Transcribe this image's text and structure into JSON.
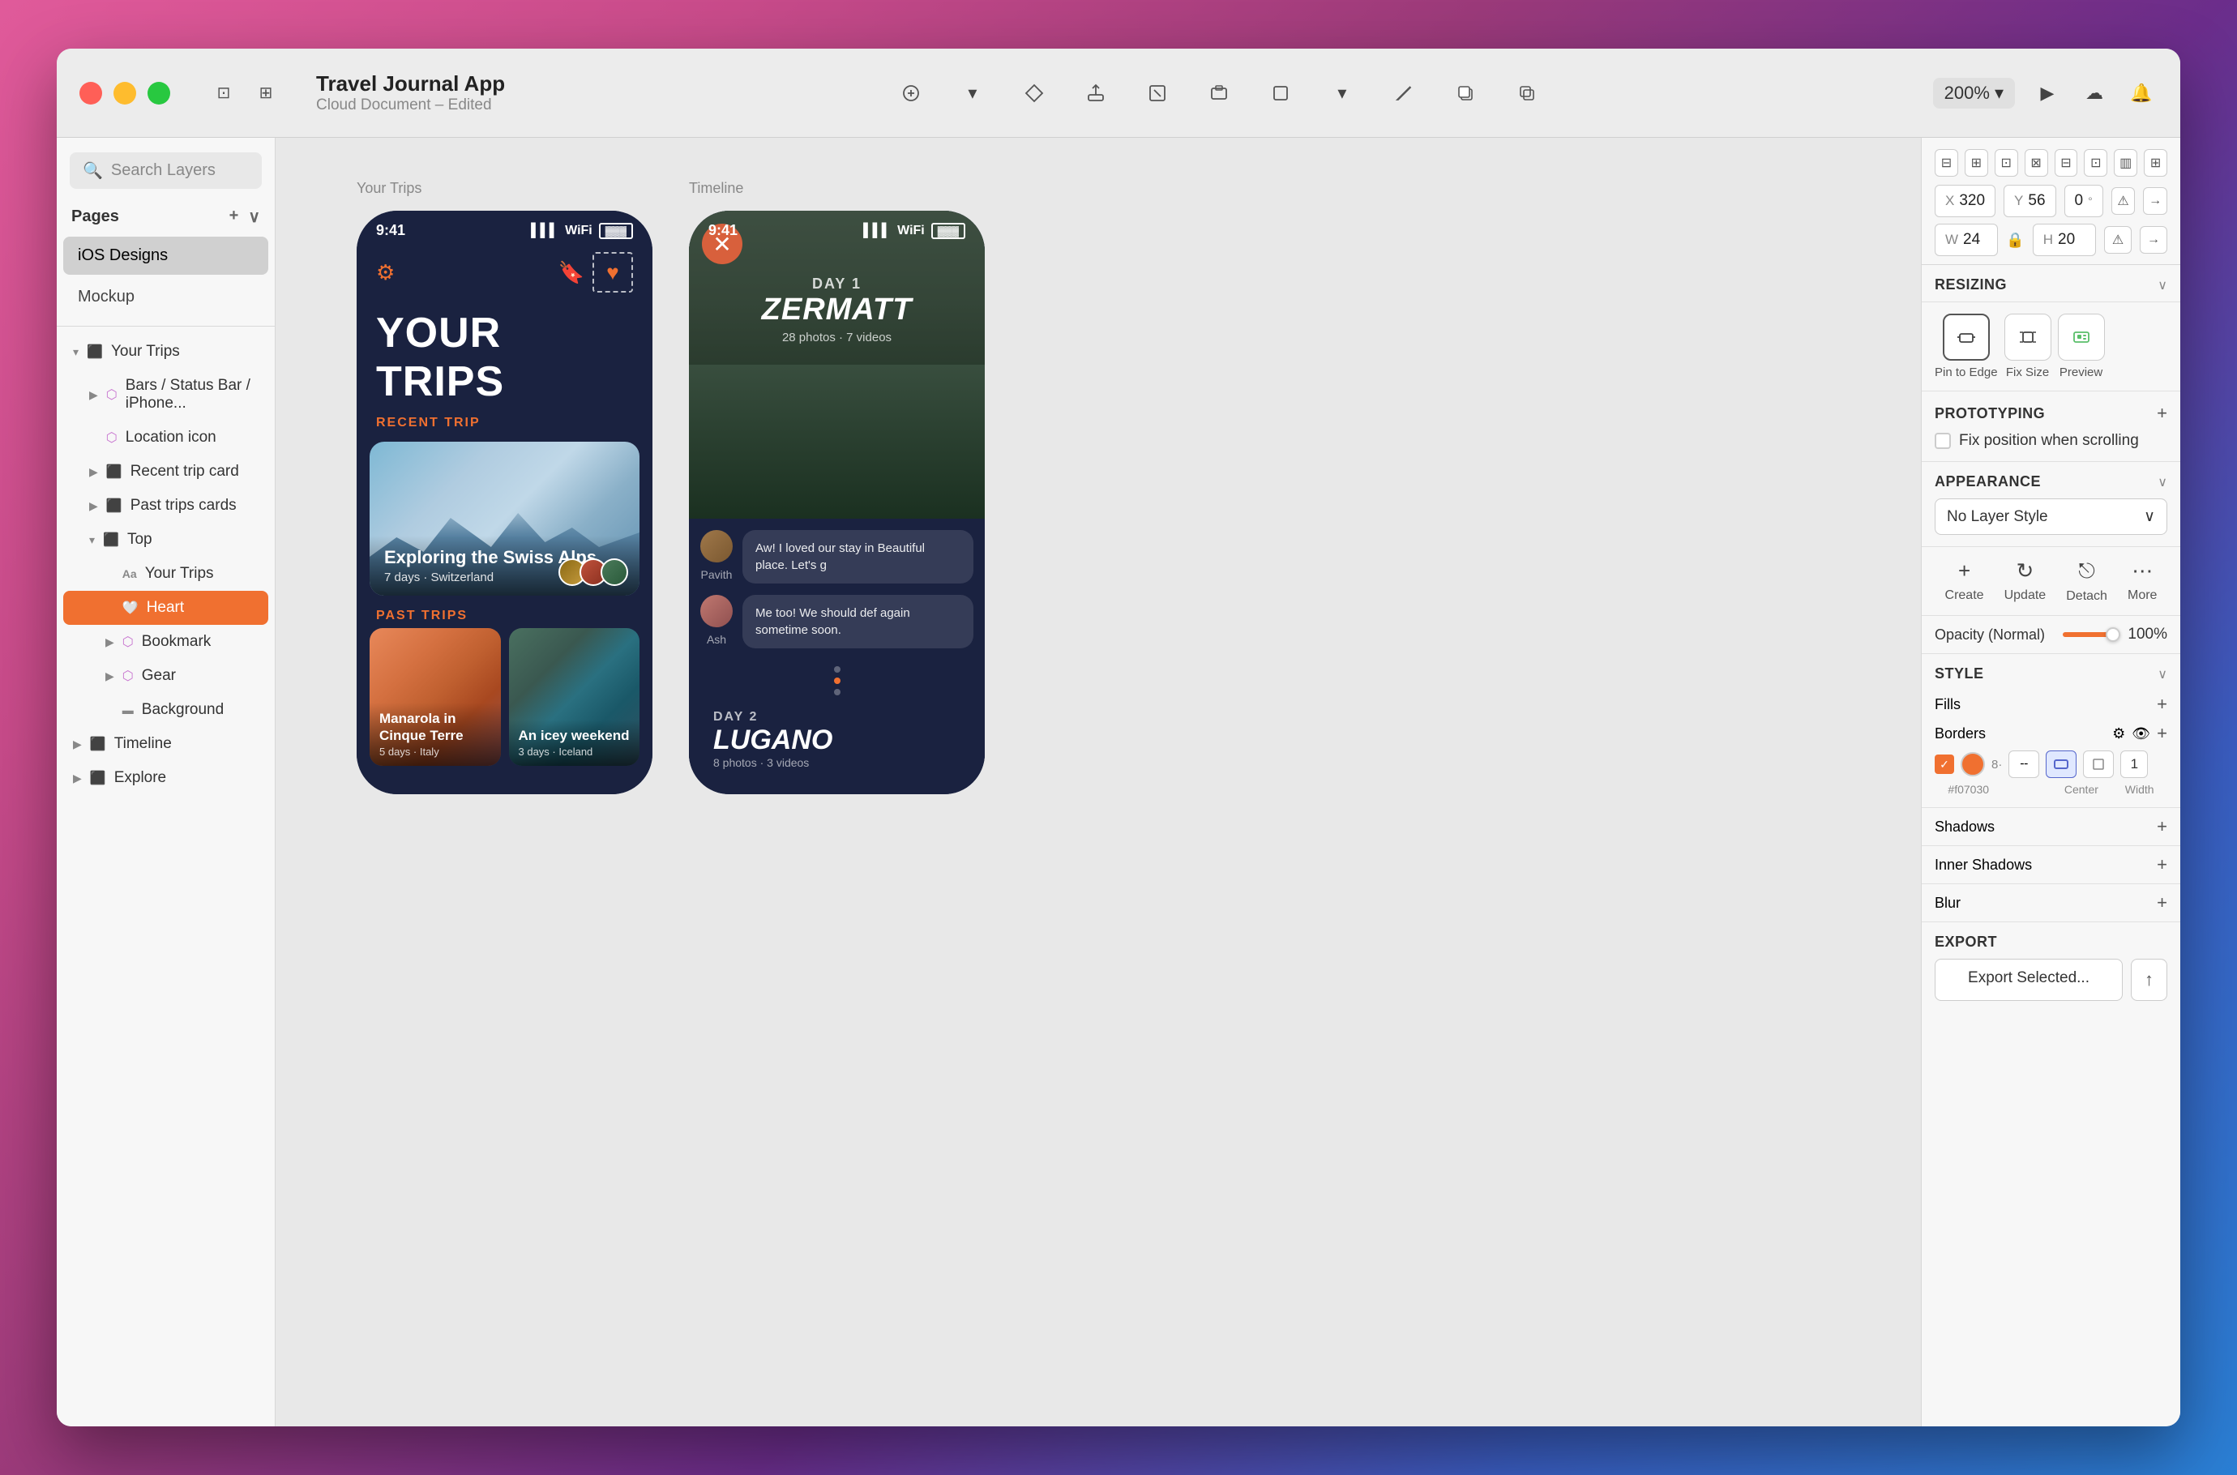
{
  "window": {
    "title": "Travel Journal App",
    "subtitle": "Cloud Document – Edited"
  },
  "titlebar": {
    "traffic_lights": [
      "red",
      "yellow",
      "green"
    ],
    "zoom_level": "200%"
  },
  "sidebar": {
    "search_placeholder": "Search Layers",
    "pages_label": "Pages",
    "pages": [
      {
        "label": "iOS Designs",
        "active": true
      },
      {
        "label": "Mockup",
        "active": false
      }
    ],
    "layers": [
      {
        "label": "Your Trips",
        "type": "group",
        "indent": 0,
        "expanded": true
      },
      {
        "label": "Bars / Status Bar / iPhone...",
        "type": "layer",
        "indent": 1
      },
      {
        "label": "Location icon",
        "type": "component",
        "indent": 1
      },
      {
        "label": "Recent trip card",
        "type": "folder",
        "indent": 1
      },
      {
        "label": "Past trips cards",
        "type": "folder",
        "indent": 1
      },
      {
        "label": "Top",
        "type": "folder",
        "indent": 1,
        "expanded": true
      },
      {
        "label": "Your Trips",
        "type": "text",
        "indent": 2
      },
      {
        "label": "Heart",
        "type": "component",
        "indent": 2,
        "selected": true
      },
      {
        "label": "Bookmark",
        "type": "component",
        "indent": 2
      },
      {
        "label": "Gear",
        "type": "component",
        "indent": 2
      },
      {
        "label": "Background",
        "type": "rect",
        "indent": 2
      },
      {
        "label": "Timeline",
        "type": "group",
        "indent": 0
      },
      {
        "label": "Explore",
        "type": "group",
        "indent": 0
      }
    ]
  },
  "canvas": {
    "label_your_trips": "Your Trips",
    "label_timeline": "Timeline",
    "phone_your_trips": {
      "status_time": "9:41",
      "title": "YOUR TRIPS",
      "recent_trip_label": "RECENT TRIP",
      "recent_trip": {
        "title": "Exploring the Swiss Alps",
        "meta": "7 days · Switzerland"
      },
      "past_trips_label": "PAST TRIPS",
      "past_trips": [
        {
          "title": "Manarola in Cinque Terre",
          "meta": "5 days · Italy"
        },
        {
          "title": "An icey weekend",
          "meta": "3 days · Iceland"
        }
      ]
    },
    "phone_timeline": {
      "status_time": "9:41",
      "day1": {
        "label": "DAY 1",
        "name": "ZERMATT",
        "photos": "28 photos · 7 videos"
      },
      "chats": [
        {
          "name": "Pavith",
          "message": "Aw! I loved our stay in \nBeautiful place. Let's g"
        },
        {
          "name": "Ash",
          "message": "Me too! We should def\nagain sometime soon."
        }
      ],
      "day2": {
        "label": "DAY 2",
        "name": "LUGANO",
        "photos": "8 photos · 3 videos"
      }
    }
  },
  "right_panel": {
    "coords": {
      "x_label": "X",
      "x_value": "320",
      "y_label": "Y",
      "y_value": "56",
      "rotation_value": "0"
    },
    "size": {
      "w_label": "W",
      "w_value": "24",
      "h_label": "H",
      "h_value": "20"
    },
    "resizing_label": "RESIZING",
    "pin_items": [
      {
        "label": "Pin to Edge"
      },
      {
        "label": "Fix Size"
      },
      {
        "label": "Preview"
      }
    ],
    "prototyping_label": "PROTOTYPING",
    "fix_scroll_label": "Fix position when scrolling",
    "appearance_label": "APPEARANCE",
    "layer_style": "No Layer Style",
    "layer_actions": [
      "Create",
      "Update",
      "Detach",
      "More"
    ],
    "opacity_label": "Opacity (Normal)",
    "opacity_value": "100%",
    "style_label": "STYLE",
    "fills_label": "Fills",
    "borders_label": "Borders",
    "border_color_hex": "#f07030",
    "border_position": "Center",
    "border_width": "1",
    "border_width_label": "Width",
    "shadows_label": "Shadows",
    "inner_shadows_label": "Inner Shadows",
    "blur_label": "Blur",
    "export_label": "EXPORT",
    "export_btn_label": "Export Selected..."
  }
}
